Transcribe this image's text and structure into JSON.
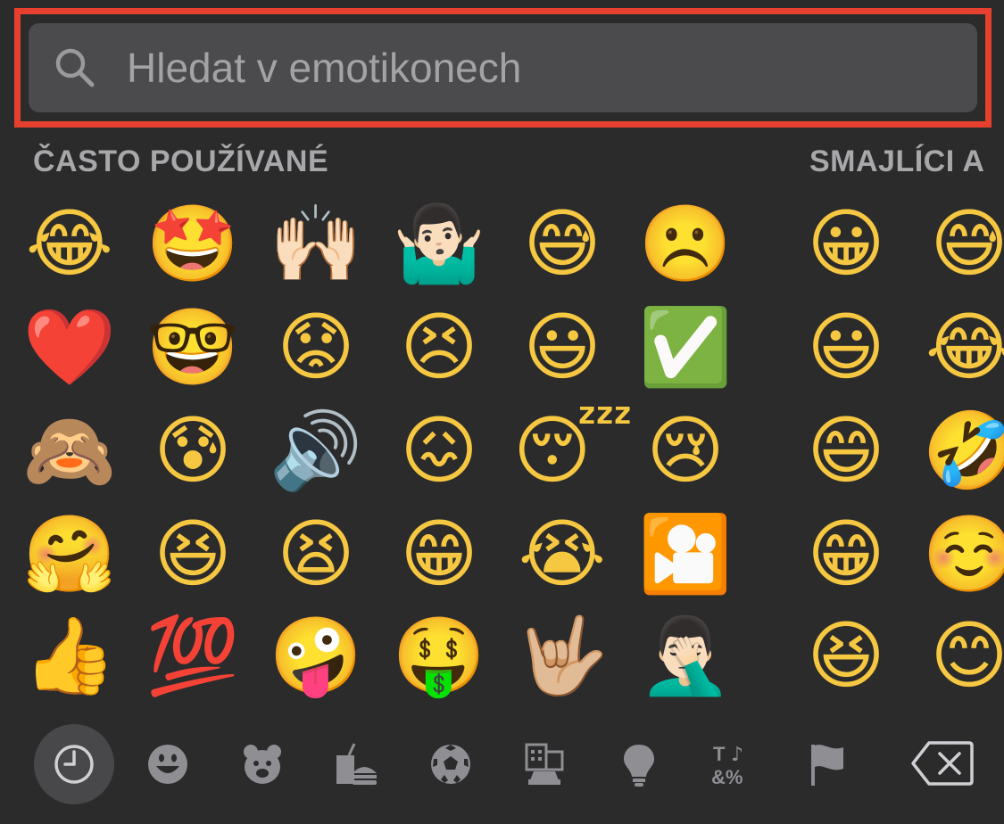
{
  "search": {
    "placeholder": "Hledat v emotikonech",
    "icon": "search-icon"
  },
  "sections": {
    "frequent": "ČASTO POUŽÍVANÉ",
    "smileys": "SMAJLÍCI A"
  },
  "frequent_emoji": [
    [
      "😂",
      "🤩",
      "🙌🏻",
      "🤷🏻‍♂️",
      "😅",
      "☹️"
    ],
    [
      "❤️",
      "🤓",
      "😟",
      "😣",
      "😃",
      "✅"
    ],
    [
      "🙈",
      "😰",
      "🔊",
      "😖",
      "😴",
      "😢"
    ],
    [
      "🤗",
      "😆",
      "😫",
      "😁",
      "😭",
      "🎦"
    ],
    [
      "👍",
      "💯",
      "🤪",
      "🤑",
      "🤟🏼",
      "🤦🏻‍♂️"
    ]
  ],
  "smileys_emoji": [
    [
      "😀",
      "😅"
    ],
    [
      "😃",
      "😂"
    ],
    [
      "😄",
      "🤣"
    ],
    [
      "😁",
      "☺️"
    ],
    [
      "😆",
      "😊"
    ]
  ],
  "tabs": [
    {
      "name": "recent-tab",
      "icon": "clock-icon",
      "active": true
    },
    {
      "name": "smileys-tab",
      "icon": "smiley-icon",
      "active": false
    },
    {
      "name": "animals-tab",
      "icon": "bear-icon",
      "active": false
    },
    {
      "name": "food-tab",
      "icon": "burger-icon",
      "active": false
    },
    {
      "name": "activity-tab",
      "icon": "soccer-ball-icon",
      "active": false
    },
    {
      "name": "travel-tab",
      "icon": "building-car-icon",
      "active": false
    },
    {
      "name": "objects-tab",
      "icon": "lightbulb-icon",
      "active": false
    },
    {
      "name": "symbols-tab",
      "icon": "symbols-icon",
      "active": false
    },
    {
      "name": "flags-tab",
      "icon": "flag-icon",
      "active": false
    }
  ],
  "delete_key": {
    "icon": "backspace-icon"
  },
  "colors": {
    "background": "#2b2b2c",
    "search_field": "#4b4b4d",
    "highlight": "#e8402e",
    "icon": "#8e8e93"
  }
}
